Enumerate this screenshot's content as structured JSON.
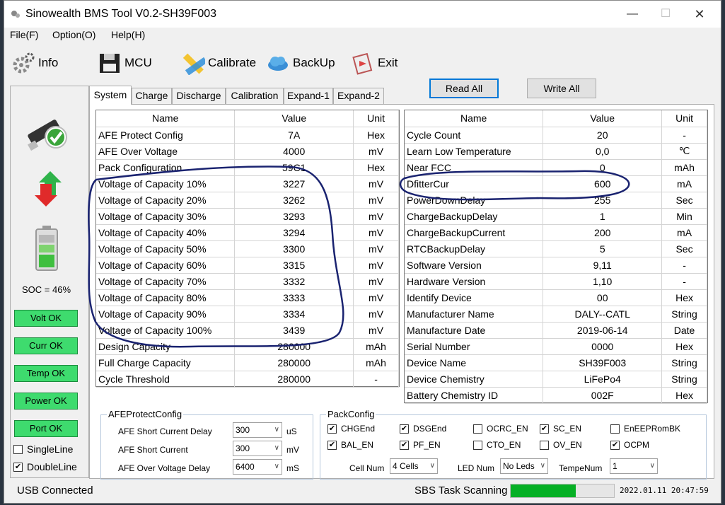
{
  "window": {
    "title": "Sinowealth BMS Tool V0.2-SH39F003"
  },
  "menu": [
    "File(F)",
    "Option(O)",
    "Help(H)"
  ],
  "toolbar": {
    "info": "Info",
    "mcu": "MCU",
    "calibrate": "Calibrate",
    "backup": "BackUp",
    "exit": "Exit"
  },
  "left": {
    "soc": "SOC = 46%",
    "status": [
      "Volt OK",
      "Curr OK",
      "Temp OK",
      "Power OK",
      "Port OK"
    ],
    "single_line": "SingleLine",
    "double_line": "DoubleLine",
    "single_checked": false,
    "double_checked": true,
    "status_color": "#3edb6e"
  },
  "tabs": [
    "System",
    "Charge",
    "Discharge",
    "Calibration",
    "Expand-1",
    "Expand-2"
  ],
  "buttons": {
    "read_all": "Read All",
    "write_all": "Write All"
  },
  "table_headers": {
    "name": "Name",
    "value": "Value",
    "unit": "Unit"
  },
  "left_table": [
    {
      "name": "AFE Protect Config",
      "value": "7A",
      "unit": "Hex"
    },
    {
      "name": "AFE Over Voltage",
      "value": "4000",
      "unit": "mV"
    },
    {
      "name": "Pack Configuration",
      "value": "59C1",
      "unit": "Hex"
    },
    {
      "name": "Voltage of Capacity 10%",
      "value": "3227",
      "unit": "mV"
    },
    {
      "name": "Voltage of Capacity 20%",
      "value": "3262",
      "unit": "mV"
    },
    {
      "name": "Voltage of Capacity 30%",
      "value": "3293",
      "unit": "mV"
    },
    {
      "name": "Voltage of Capacity 40%",
      "value": "3294",
      "unit": "mV"
    },
    {
      "name": "Voltage of Capacity 50%",
      "value": "3300",
      "unit": "mV"
    },
    {
      "name": "Voltage of Capacity 60%",
      "value": "3315",
      "unit": "mV"
    },
    {
      "name": "Voltage of Capacity 70%",
      "value": "3332",
      "unit": "mV"
    },
    {
      "name": "Voltage of Capacity 80%",
      "value": "3333",
      "unit": "mV"
    },
    {
      "name": "Voltage of Capacity 90%",
      "value": "3334",
      "unit": "mV"
    },
    {
      "name": "Voltage of Capacity 100%",
      "value": "3439",
      "unit": "mV"
    },
    {
      "name": "Design Capacity",
      "value": "280000",
      "unit": "mAh"
    },
    {
      "name": "Full Charge Capacity",
      "value": "280000",
      "unit": "mAh"
    },
    {
      "name": "Cycle Threshold",
      "value": "280000",
      "unit": "-"
    }
  ],
  "right_table": [
    {
      "name": "Cycle Count",
      "value": "20",
      "unit": "-"
    },
    {
      "name": "Learn Low Temperature",
      "value": "0,0",
      "unit": "℃"
    },
    {
      "name": "Near FCC",
      "value": "0",
      "unit": "mAh"
    },
    {
      "name": "DfitterCur",
      "value": "600",
      "unit": "mA"
    },
    {
      "name": "PowerDownDelay",
      "value": "255",
      "unit": "Sec"
    },
    {
      "name": "ChargeBackupDelay",
      "value": "1",
      "unit": "Min"
    },
    {
      "name": "ChargeBackupCurrent",
      "value": "200",
      "unit": "mA"
    },
    {
      "name": "RTCBackupDelay",
      "value": "5",
      "unit": "Sec"
    },
    {
      "name": "Software Version",
      "value": "9,11",
      "unit": "-"
    },
    {
      "name": "Hardware Version",
      "value": "1,10",
      "unit": "-"
    },
    {
      "name": "Identify Device",
      "value": "00",
      "unit": "Hex"
    },
    {
      "name": "Manufacturer Name",
      "value": "DALY--CATL",
      "unit": "String"
    },
    {
      "name": "Manufacture Date",
      "value": "2019-06-14",
      "unit": "Date"
    },
    {
      "name": "Serial Number",
      "value": "0000",
      "unit": "Hex"
    },
    {
      "name": "Device Name",
      "value": "SH39F003",
      "unit": "String"
    },
    {
      "name": "Device Chemistry",
      "value": "LiFePo4",
      "unit": "String"
    },
    {
      "name": "Battery Chemistry ID",
      "value": "002F",
      "unit": "Hex"
    }
  ],
  "afe": {
    "legend": "AFEProtectConfig",
    "rows": [
      {
        "label": "AFE Short Current Delay",
        "value": "300",
        "unit": "uS"
      },
      {
        "label": "AFE Short Current",
        "value": "300",
        "unit": "mV"
      },
      {
        "label": "AFE Over Voltage Delay",
        "value": "6400",
        "unit": "mS"
      }
    ]
  },
  "pack": {
    "legend": "PackConfig",
    "checks": [
      {
        "label": "CHGEnd",
        "checked": true
      },
      {
        "label": "DSGEnd",
        "checked": true
      },
      {
        "label": "OCRC_EN",
        "checked": false
      },
      {
        "label": "SC_EN",
        "checked": true
      },
      {
        "label": "EnEEPRomBK",
        "checked": false
      },
      {
        "label": "BAL_EN",
        "checked": true
      },
      {
        "label": "PF_EN",
        "checked": true
      },
      {
        "label": "CTO_EN",
        "checked": false
      },
      {
        "label": "OV_EN",
        "checked": false
      },
      {
        "label": "OCPM",
        "checked": true
      }
    ],
    "cell_num_label": "Cell Num",
    "cell_num_value": "4 Cells",
    "led_num_label": "LED Num",
    "led_num_value": "No Leds",
    "tempe_num_label": "TempeNum",
    "tempe_num_value": "1"
  },
  "status": {
    "connection": "USB Connected",
    "task": "SBS Task Scanning",
    "progress": 0.63,
    "progress_color": "#06b025",
    "datetime": "2022.01.11 20:47:59"
  },
  "annotation_color": "#1a2370"
}
